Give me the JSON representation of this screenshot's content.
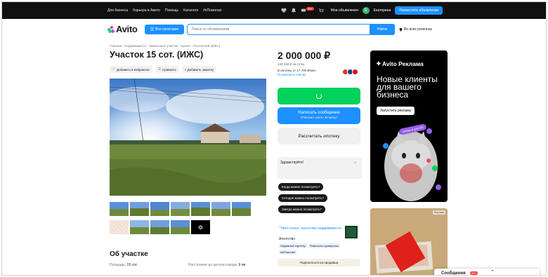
{
  "topbar": {
    "nav": [
      "Для бизнеса",
      "Карьера в Авито",
      "Помощь",
      "Каталоги",
      "#яПомогаю"
    ],
    "notif_count": "99+",
    "my_ads": "Мои объявления",
    "user_initial": "Е",
    "user_name": "Екатерина",
    "post_button": "Разместить объявление"
  },
  "header": {
    "logo": "Avito",
    "categories_button": "Все категории",
    "search_placeholder": "Поиск по объявлениям",
    "search_button": "Найти",
    "region": "Во всех регионах"
  },
  "listing": {
    "breadcrumb": "Главная › Недвижимость › Земельные участки › Купить › Поселений (ИЖС)",
    "title": "Участок 15 сот. (ИЖС)",
    "actions": [
      "Добавить в избранное",
      "Сравнить",
      "Добавить заметку"
    ],
    "about_heading": "Об участке",
    "area_label": "Площадь:",
    "area_value": "15 сот.",
    "distance_label": "Расстояние до центра города:",
    "distance_value": "9 км"
  },
  "pricing": {
    "price": "2 000 000 ₽",
    "per_acre": "133 333 ₽ за сотку",
    "mortgage": "В ипотеку от 17 705 ₽/мес.",
    "mortgage_link": "Посмотреть сейчас",
    "message_button": "Написать сообщение",
    "message_sub": "Отвечает около 30 минут",
    "mortgage_button": "Рассчитать ипотеку"
  },
  "chat": {
    "greeting": "Здравствуйте!",
    "quick_replies": [
      "Когда можно посмотреть?",
      "Сегодня можно посмотреть?",
      "Завтра можно посмотреть?"
    ]
  },
  "seller": {
    "name": "\"Твои стены\" агентство недвижимости",
    "type": "Агентство",
    "tags": [
      "Надёжный партнёр",
      "Реквизиты проверены",
      "#яПомогаю"
    ],
    "subscribe": "Подписаться на продавца"
  },
  "ad": {
    "brand": "Avito Реклама",
    "headline": "Новые клиенты для вашего бизнеса",
    "cta": "Запустить рекламу",
    "sticker": "теперь и для ИП",
    "label2": "Реклама"
  },
  "messages_bar": {
    "label": "Сообщения",
    "count": "99+"
  },
  "colors": {
    "accent": "#1e90ff",
    "green": "#02d15c",
    "dark": "#111111"
  }
}
